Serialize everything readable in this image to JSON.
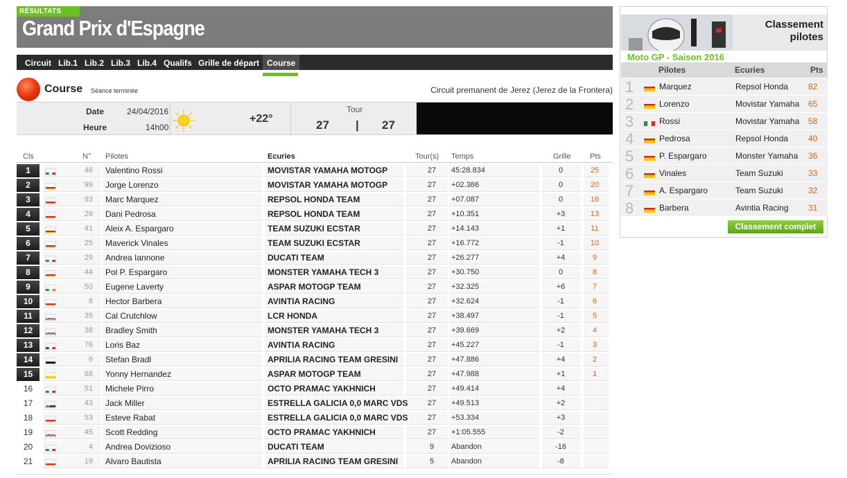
{
  "header": {
    "tag": "RÉSULTATS",
    "title": "Grand Prix d'Espagne"
  },
  "nav": {
    "tabs": [
      "Circuit",
      "Lib.1",
      "Lib.2",
      "Lib.3",
      "Lib.4",
      "Qualifs",
      "Grille de départ",
      "Course"
    ],
    "active": "Course"
  },
  "session": {
    "title": "Course",
    "status": "Séance terminée",
    "circuit": "Circuit premanent de Jerez (Jerez de la Frontera)",
    "date_label": "Date",
    "date_value": "24/04/2016",
    "hour_label": "Heure",
    "hour_value": "14h00",
    "temperature": "+22°",
    "tour_label": "Tour",
    "tour_current": "27",
    "tour_separator": "|",
    "tour_total": "27"
  },
  "table": {
    "headers": {
      "cls": "Cls",
      "num": "N°",
      "pilotes": "Pilotes",
      "ecuries": "Ecuries",
      "tours": "Tour(s)",
      "temps": "Temps",
      "grille": "Grille",
      "pts": "Pts"
    },
    "rows": [
      {
        "cls": "1",
        "flag": "it",
        "num": "46",
        "pilote": "Valentino Rossi",
        "ecurie": "MOVISTAR YAMAHA MOTOGP",
        "tours": "27",
        "temps": "45:28.834",
        "grille": "0",
        "pts": "25"
      },
      {
        "cls": "2",
        "flag": "es",
        "num": "99",
        "pilote": "Jorge Lorenzo",
        "ecurie": "MOVISTAR YAMAHA MOTOGP",
        "tours": "27",
        "temps": "+02.386",
        "grille": "0",
        "pts": "20"
      },
      {
        "cls": "3",
        "flag": "es",
        "num": "93",
        "pilote": "Marc Marquez",
        "ecurie": "REPSOL HONDA TEAM",
        "tours": "27",
        "temps": "+07.087",
        "grille": "0",
        "pts": "16"
      },
      {
        "cls": "4",
        "flag": "es",
        "num": "26",
        "pilote": "Dani Pedrosa",
        "ecurie": "REPSOL HONDA TEAM",
        "tours": "27",
        "temps": "+10.351",
        "grille": "+3",
        "pts": "13"
      },
      {
        "cls": "5",
        "flag": "es",
        "num": "41",
        "pilote": "Aleix A. Espargaro",
        "ecurie": "TEAM SUZUKI ECSTAR",
        "tours": "27",
        "temps": "+14.143",
        "grille": "+1",
        "pts": "11"
      },
      {
        "cls": "6",
        "flag": "es",
        "num": "25",
        "pilote": "Maverick Vinales",
        "ecurie": "TEAM SUZUKI ECSTAR",
        "tours": "27",
        "temps": "+16.772",
        "grille": "-1",
        "pts": "10"
      },
      {
        "cls": "7",
        "flag": "it",
        "num": "29",
        "pilote": "Andrea Iannone",
        "ecurie": "DUCATI TEAM",
        "tours": "27",
        "temps": "+26.277",
        "grille": "+4",
        "pts": "9"
      },
      {
        "cls": "8",
        "flag": "es",
        "num": "44",
        "pilote": "Pol P. Espargaro",
        "ecurie": "MONSTER YAMAHA TECH 3",
        "tours": "27",
        "temps": "+30.750",
        "grille": "0",
        "pts": "8"
      },
      {
        "cls": "9",
        "flag": "ie",
        "num": "50",
        "pilote": "Eugene Laverty",
        "ecurie": "ASPAR MOTOGP TEAM",
        "tours": "27",
        "temps": "+32.325",
        "grille": "+6",
        "pts": "7"
      },
      {
        "cls": "10",
        "flag": "es",
        "num": "8",
        "pilote": "Hector Barbera",
        "ecurie": "AVINTIA RACING",
        "tours": "27",
        "temps": "+32.624",
        "grille": "-1",
        "pts": "6"
      },
      {
        "cls": "11",
        "flag": "gb",
        "num": "35",
        "pilote": "Cal Crutchlow",
        "ecurie": "LCR HONDA",
        "tours": "27",
        "temps": "+38.497",
        "grille": "-1",
        "pts": "5"
      },
      {
        "cls": "12",
        "flag": "gb",
        "num": "38",
        "pilote": "Bradley Smith",
        "ecurie": "MONSTER YAMAHA TECH 3",
        "tours": "27",
        "temps": "+39.669",
        "grille": "+2",
        "pts": "4"
      },
      {
        "cls": "13",
        "flag": "fr",
        "num": "76",
        "pilote": "Loris Baz",
        "ecurie": "AVINTIA RACING",
        "tours": "27",
        "temps": "+45.227",
        "grille": "-1",
        "pts": "3"
      },
      {
        "cls": "14",
        "flag": "de",
        "num": "6",
        "pilote": "Stefan Bradl",
        "ecurie": "APRILIA RACING TEAM GRESINI",
        "tours": "27",
        "temps": "+47.886",
        "grille": "+4",
        "pts": "2"
      },
      {
        "cls": "15",
        "flag": "co",
        "num": "68",
        "pilote": "Yonny Hernandez",
        "ecurie": "ASPAR MOTOGP TEAM",
        "tours": "27",
        "temps": "+47.988",
        "grille": "+1",
        "pts": "1"
      },
      {
        "cls": "16",
        "flag": "it",
        "num": "51",
        "pilote": "Michele Pirro",
        "ecurie": "OCTO PRAMAC YAKHNICH",
        "tours": "27",
        "temps": "+49.414",
        "grille": "+4",
        "pts": ""
      },
      {
        "cls": "17",
        "flag": "au",
        "num": "43",
        "pilote": "Jack Miller",
        "ecurie": "ESTRELLA GALICIA 0,0 MARC VDS",
        "tours": "27",
        "temps": "+49.513",
        "grille": "+2",
        "pts": ""
      },
      {
        "cls": "18",
        "flag": "es",
        "num": "53",
        "pilote": "Esteve Rabat",
        "ecurie": "ESTRELLA GALICIA 0,0 MARC VDS",
        "tours": "27",
        "temps": "+53.334",
        "grille": "+3",
        "pts": ""
      },
      {
        "cls": "19",
        "flag": "gb",
        "num": "45",
        "pilote": "Scott Redding",
        "ecurie": "OCTO PRAMAC YAKHNICH",
        "tours": "27",
        "temps": "+1:05.555",
        "grille": "-2",
        "pts": ""
      },
      {
        "cls": "20",
        "flag": "it",
        "num": "4",
        "pilote": "Andrea Dovizioso",
        "ecurie": "DUCATI TEAM",
        "tours": "9",
        "temps": "Abandon",
        "grille": "-16",
        "pts": ""
      },
      {
        "cls": "21",
        "flag": "es",
        "num": "19",
        "pilote": "Alvaro Bautista",
        "ecurie": "APRILIA RACING TEAM GRESINI",
        "tours": "5",
        "temps": "Abandon",
        "grille": "-8",
        "pts": ""
      }
    ]
  },
  "sidebar": {
    "title_line1": "Classement",
    "title_line2": "pilotes",
    "subtitle": "Moto GP - Saison 2016",
    "headers": {
      "pilotes": "Pilotes",
      "ecuries": "Ecuries",
      "pts": "Pts"
    },
    "rows": [
      {
        "pos": "1",
        "flag": "es",
        "pilote": "Marquez",
        "ecurie": "Repsol Honda",
        "pts": "82"
      },
      {
        "pos": "2",
        "flag": "es",
        "pilote": "Lorenzo",
        "ecurie": "Movistar Yamaha",
        "pts": "65"
      },
      {
        "pos": "3",
        "flag": "it",
        "pilote": "Rossi",
        "ecurie": "Movistar Yamaha",
        "pts": "58"
      },
      {
        "pos": "4",
        "flag": "es",
        "pilote": "Pedrosa",
        "ecurie": "Repsol Honda",
        "pts": "40"
      },
      {
        "pos": "5",
        "flag": "es",
        "pilote": "P. Espargaro",
        "ecurie": "Monster Yamaha",
        "pts": "36"
      },
      {
        "pos": "6",
        "flag": "es",
        "pilote": "Vinales",
        "ecurie": "Team Suzuki",
        "pts": "33"
      },
      {
        "pos": "7",
        "flag": "es",
        "pilote": "A. Espargaro",
        "ecurie": "Team Suzuki",
        "pts": "32"
      },
      {
        "pos": "8",
        "flag": "es",
        "pilote": "Barbera",
        "ecurie": "Avintia Racing",
        "pts": "31"
      }
    ],
    "button": "Classement complet"
  },
  "colors": {
    "accent_green": "#6cc01f",
    "points_orange": "#e05f10",
    "header_grey": "#7c7c7c",
    "nav_dark": "#2b2b2b"
  }
}
